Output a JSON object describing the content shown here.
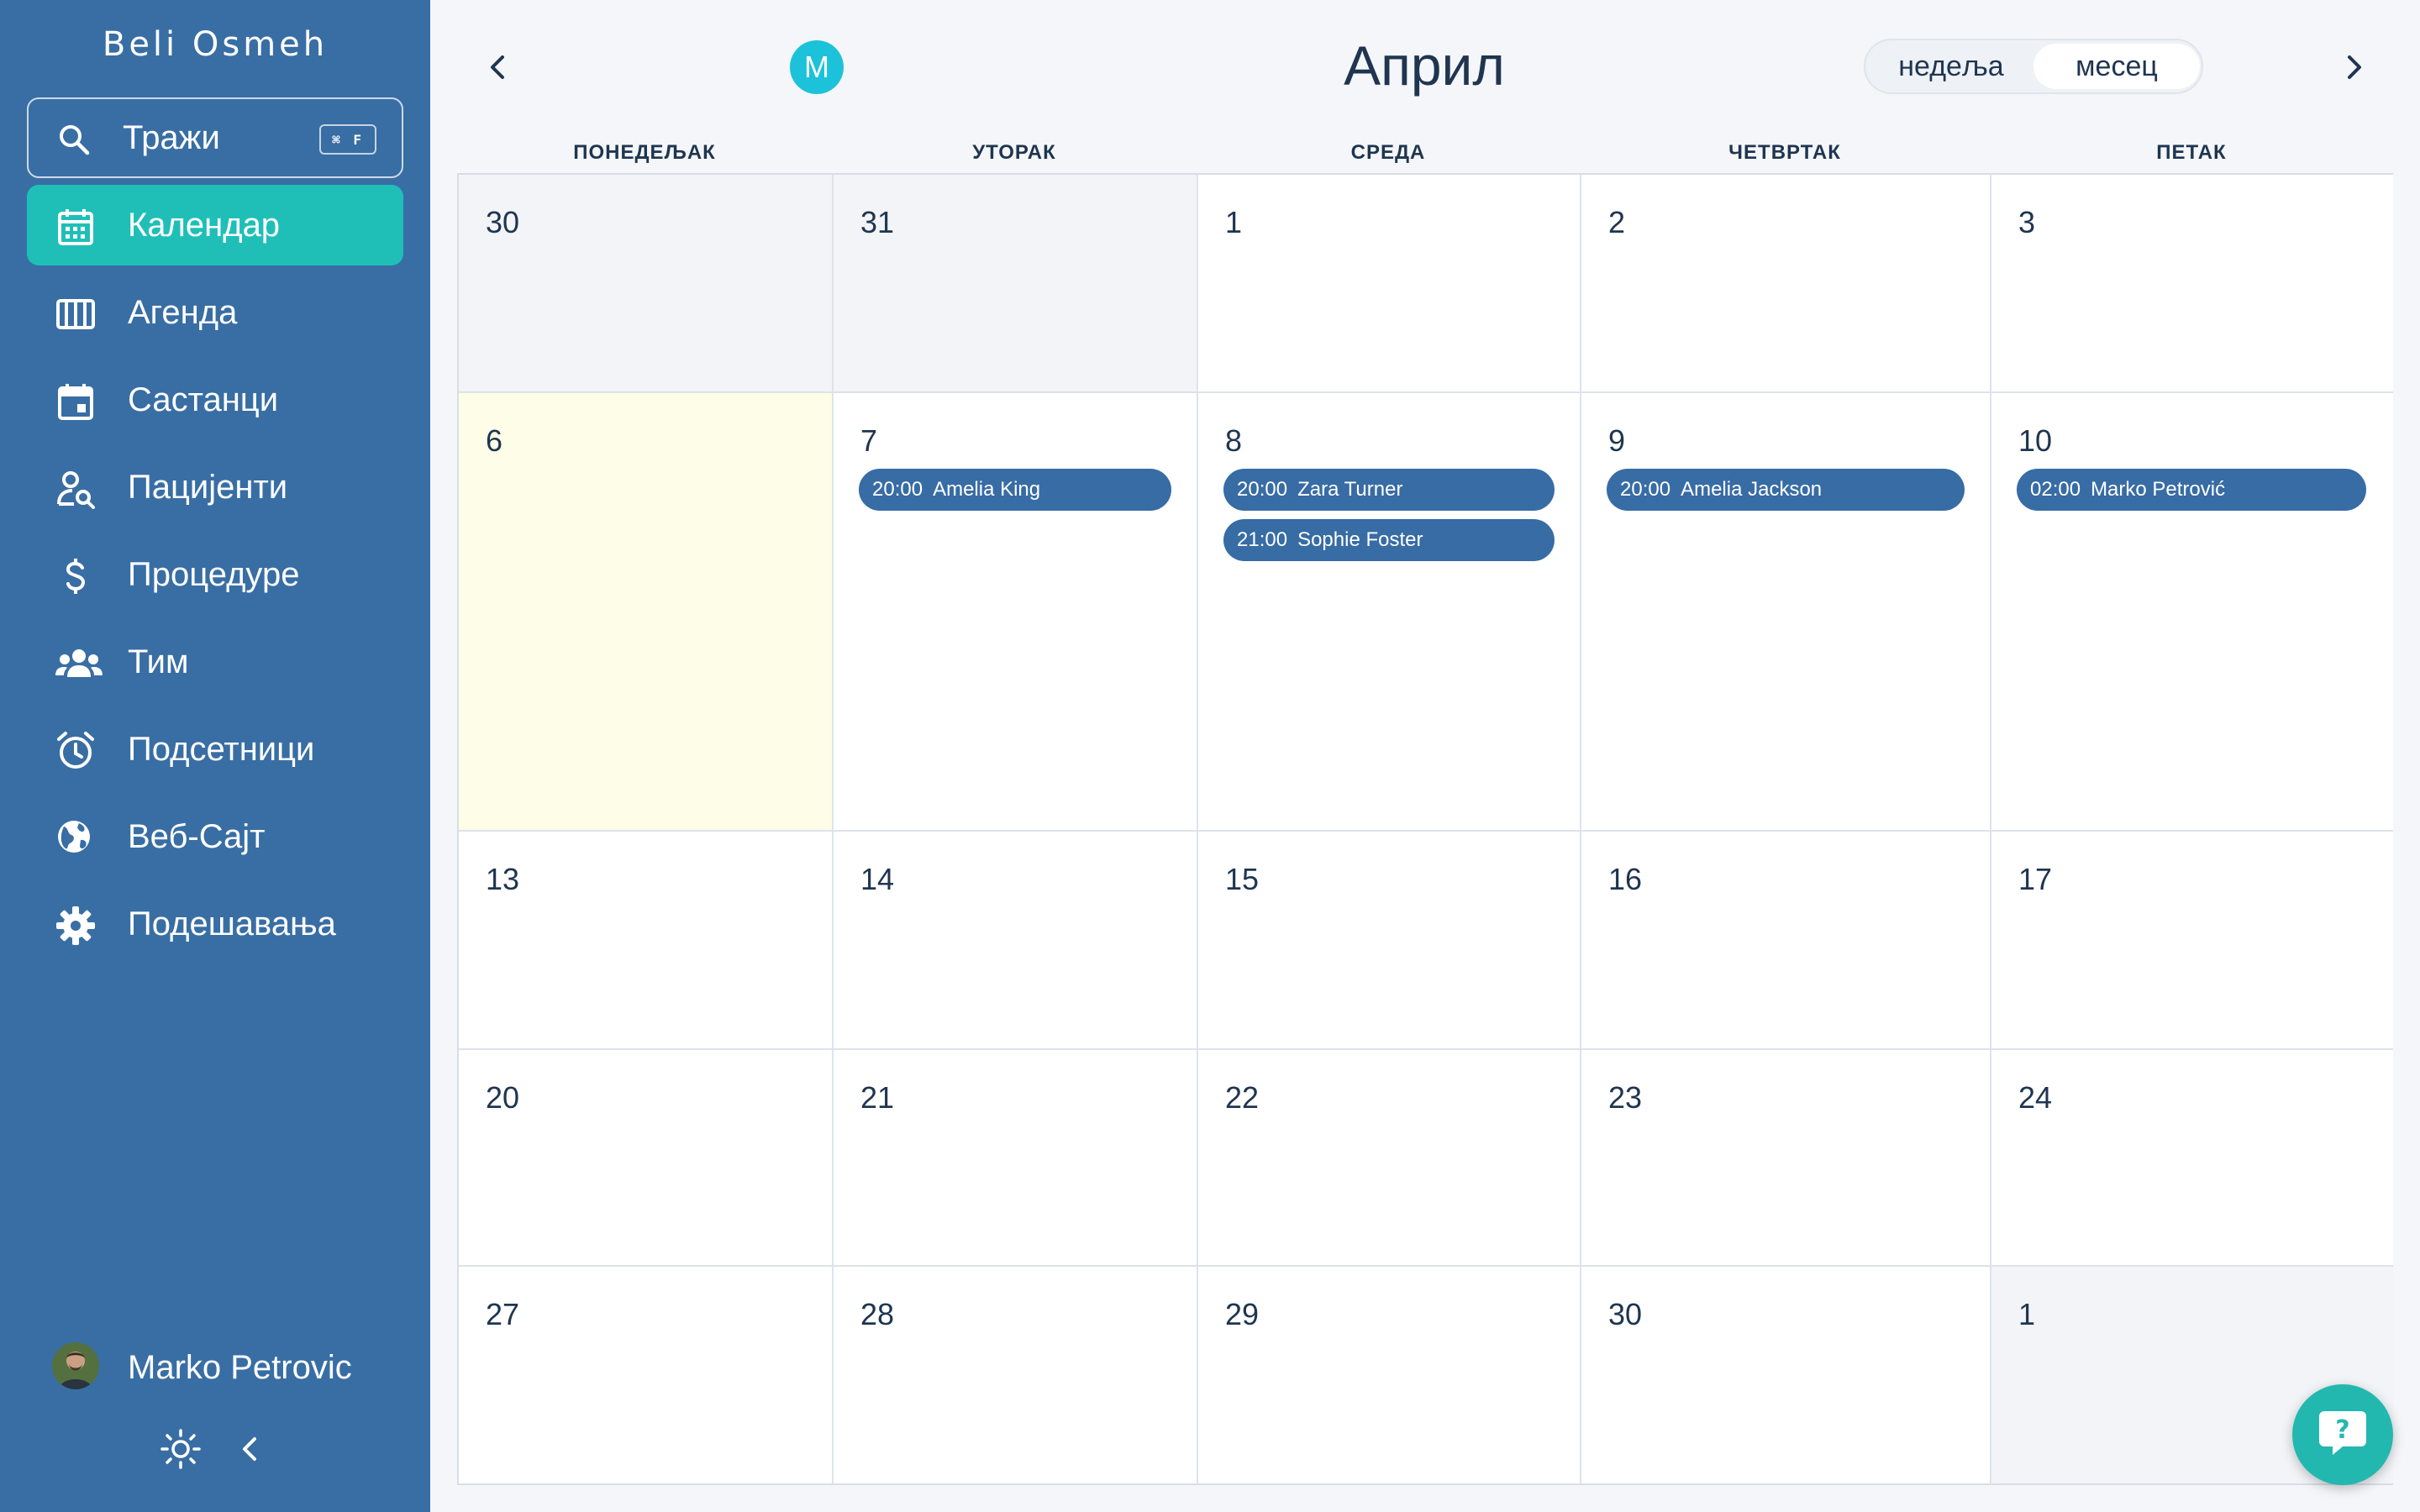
{
  "app": {
    "brand": "Beli Osmeh"
  },
  "search": {
    "label": "Тражи",
    "shortcut": "⌘ F"
  },
  "sidebar": {
    "items": [
      {
        "label": "Календар",
        "icon": "calendar-icon",
        "active": true
      },
      {
        "label": "Агенда",
        "icon": "agenda-icon",
        "active": false
      },
      {
        "label": "Састанци",
        "icon": "calendar-event-icon",
        "active": false
      },
      {
        "label": "Пацијенти",
        "icon": "user-search-icon",
        "active": false
      },
      {
        "label": "Процедуре",
        "icon": "dollar-icon",
        "active": false
      },
      {
        "label": "Тим",
        "icon": "team-icon",
        "active": false
      },
      {
        "label": "Подсетници",
        "icon": "alarm-icon",
        "active": false
      },
      {
        "label": "Веб-Сајт",
        "icon": "globe-icon",
        "active": false
      },
      {
        "label": "Подешавања",
        "icon": "gear-icon",
        "active": false
      }
    ],
    "user": {
      "name": "Marko Petrovic"
    }
  },
  "header": {
    "badge": "M",
    "month": "Април",
    "view_week": "недеља",
    "view_month": "месец",
    "selected_view": "month"
  },
  "calendar": {
    "weekdays": [
      "ПОНЕДЕЉАК",
      "УТОРАК",
      "СРЕДА",
      "ЧЕТВРТАК",
      "ПЕТАК"
    ],
    "weeks": [
      [
        {
          "day": "30",
          "other": true
        },
        {
          "day": "31",
          "other": true
        },
        {
          "day": "1"
        },
        {
          "day": "2"
        },
        {
          "day": "3"
        }
      ],
      [
        {
          "day": "6",
          "today": true
        },
        {
          "day": "7",
          "events": [
            {
              "time": "20:00",
              "name": "Amelia King"
            }
          ]
        },
        {
          "day": "8",
          "events": [
            {
              "time": "20:00",
              "name": "Zara Turner"
            },
            {
              "time": "21:00",
              "name": "Sophie Foster"
            }
          ]
        },
        {
          "day": "9",
          "events": [
            {
              "time": "20:00",
              "name": "Amelia Jackson"
            }
          ]
        },
        {
          "day": "10",
          "events": [
            {
              "time": "02:00",
              "name": "Marko Petrović"
            }
          ]
        }
      ],
      [
        {
          "day": "13"
        },
        {
          "day": "14"
        },
        {
          "day": "15"
        },
        {
          "day": "16"
        },
        {
          "day": "17"
        }
      ],
      [
        {
          "day": "20"
        },
        {
          "day": "21"
        },
        {
          "day": "22"
        },
        {
          "day": "23"
        },
        {
          "day": "24"
        }
      ],
      [
        {
          "day": "27"
        },
        {
          "day": "28"
        },
        {
          "day": "29"
        },
        {
          "day": "30"
        },
        {
          "day": "1",
          "other": true
        }
      ]
    ]
  },
  "colors": {
    "sidebar": "#396ea4",
    "accent": "#1fbfb8",
    "event": "#376ca5",
    "today": "#fefee8",
    "badge": "#1cc2d9"
  }
}
